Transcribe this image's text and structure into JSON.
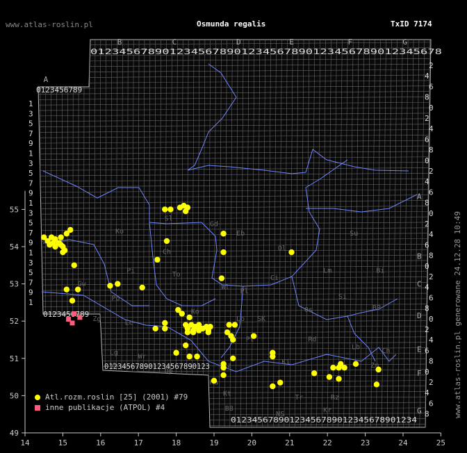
{
  "header": {
    "site": "www.atlas-roslin.pl",
    "title": "Osmunda regalis",
    "taxid": "TxID 7174"
  },
  "side_text": "www.atlas-roslin.pl generowane 24.12.28 10:49",
  "legend": [
    {
      "label": "Atl.rozm.roslin [25] (2001) #79",
      "color": "#ffff00",
      "shape": "circle"
    },
    {
      "label": "inne publikacje (ATPOL) #4",
      "color": "#ff5a7a",
      "shape": "square"
    }
  ],
  "chart_data": {
    "type": "scatter",
    "x_axis": {
      "range": [
        14,
        25
      ],
      "ticks": [
        14,
        15,
        16,
        17,
        18,
        19,
        20,
        21,
        22,
        23,
        24,
        25
      ]
    },
    "y_axis": {
      "range": [
        49,
        55.5
      ],
      "ticks": [
        49,
        50,
        51,
        52,
        53,
        54,
        55
      ]
    },
    "atpol_columns": [
      {
        "letter": "A",
        "lon": 14.55
      },
      {
        "letter": "B",
        "lon": 16.5
      },
      {
        "letter": "C",
        "lon": 17.95
      },
      {
        "letter": "D",
        "lon": 19.65
      },
      {
        "letter": "E",
        "lon": 21.05
      },
      {
        "letter": "F",
        "lon": 22.6
      },
      {
        "letter": "G",
        "lon": 24.05
      }
    ],
    "atpol_rows": [
      {
        "letter": "A",
        "lat": 55.35
      },
      {
        "letter": "B",
        "lat": 53.75
      },
      {
        "letter": "C",
        "lat": 53.0
      },
      {
        "letter": "D",
        "lat": 52.15
      },
      {
        "letter": "E",
        "lat": 51.25
      },
      {
        "letter": "F",
        "lat": 50.6
      },
      {
        "letter": "G",
        "lat": 49.6
      }
    ],
    "region_labels": [
      {
        "text": "Sl",
        "lon": 17.8,
        "lat": 54.7
      },
      {
        "text": "Gd",
        "lon": 19.0,
        "lat": 54.55
      },
      {
        "text": "Eb",
        "lon": 19.7,
        "lat": 54.3
      },
      {
        "text": "Su",
        "lon": 22.7,
        "lat": 54.3
      },
      {
        "text": "Ko",
        "lon": 16.5,
        "lat": 54.35
      },
      {
        "text": "Ol",
        "lon": 20.8,
        "lat": 53.9
      },
      {
        "text": "Ch",
        "lon": 17.75,
        "lat": 53.8
      },
      {
        "text": "Bi",
        "lon": 23.4,
        "lat": 53.3
      },
      {
        "text": "Lm",
        "lon": 22.0,
        "lat": 53.3
      },
      {
        "text": "Ci",
        "lon": 20.6,
        "lat": 53.1
      },
      {
        "text": "Pi",
        "lon": 16.8,
        "lat": 53.3
      },
      {
        "text": "To",
        "lon": 18.0,
        "lat": 53.2
      },
      {
        "text": "Wl",
        "lon": 19.3,
        "lat": 52.85
      },
      {
        "text": "Gw",
        "lon": 15.5,
        "lat": 52.95
      },
      {
        "text": "Pl",
        "lon": 19.8,
        "lat": 52.75
      },
      {
        "text": "Os",
        "lon": 21.5,
        "lat": 52.25
      },
      {
        "text": "Si",
        "lon": 22.4,
        "lat": 52.6
      },
      {
        "text": "BP",
        "lon": 23.3,
        "lat": 52.3
      },
      {
        "text": "Po",
        "lon": 16.4,
        "lat": 52.55
      },
      {
        "text": "Zg",
        "lon": 15.9,
        "lat": 52.0
      },
      {
        "text": "Ko",
        "lon": 18.5,
        "lat": 52.2
      },
      {
        "text": "Lo",
        "lon": 19.7,
        "lat": 52.0
      },
      {
        "text": "SK",
        "lon": 20.25,
        "lat": 52.0
      },
      {
        "text": "Le",
        "lon": 16.75,
        "lat": 51.9
      },
      {
        "text": "Ka",
        "lon": 18.3,
        "lat": 51.8
      },
      {
        "text": "Pt",
        "lon": 19.95,
        "lat": 51.45
      },
      {
        "text": "Rd",
        "lon": 21.6,
        "lat": 51.45
      },
      {
        "text": "Lb",
        "lon": 22.75,
        "lat": 51.25
      },
      {
        "text": "Lg",
        "lon": 16.35,
        "lat": 51.1
      },
      {
        "text": "Wr",
        "lon": 17.1,
        "lat": 51.0
      },
      {
        "text": "Ch",
        "lon": 23.55,
        "lat": 51.15
      },
      {
        "text": "Ki",
        "lon": 20.9,
        "lat": 50.85
      },
      {
        "text": "Cz",
        "lon": 19.35,
        "lat": 50.75
      },
      {
        "text": "Wb",
        "lon": 16.35,
        "lat": 50.75
      },
      {
        "text": "Op",
        "lon": 17.8,
        "lat": 50.6
      },
      {
        "text": "Zm",
        "lon": 23.25,
        "lat": 50.75
      },
      {
        "text": "Ka",
        "lon": 19.0,
        "lat": 50.3
      },
      {
        "text": "Kt",
        "lon": 19.35,
        "lat": 50.0
      },
      {
        "text": "Tr",
        "lon": 21.25,
        "lat": 49.9
      },
      {
        "text": "Rz",
        "lon": 22.2,
        "lat": 49.9
      },
      {
        "text": "Kr",
        "lon": 22.0,
        "lat": 49.55
      },
      {
        "text": "BB",
        "lon": 19.4,
        "lat": 49.6
      },
      {
        "text": "NS",
        "lon": 20.75,
        "lat": 49.45
      }
    ],
    "series": [
      {
        "name": "Atl.rozm.roslin [25] (2001) #79",
        "points": [
          [
            14.5,
            54.25
          ],
          [
            14.6,
            54.15
          ],
          [
            14.7,
            54.25
          ],
          [
            14.65,
            54.05
          ],
          [
            14.8,
            54.2
          ],
          [
            14.9,
            54.1
          ],
          [
            14.95,
            54.25
          ],
          [
            15.1,
            54.35
          ],
          [
            15.0,
            54.0
          ],
          [
            15.05,
            53.9
          ],
          [
            14.95,
            54.05
          ],
          [
            15.0,
            53.85
          ],
          [
            14.75,
            54.1
          ],
          [
            14.8,
            54.0
          ],
          [
            15.2,
            54.45
          ],
          [
            15.3,
            53.5
          ],
          [
            15.1,
            52.85
          ],
          [
            15.4,
            52.85
          ],
          [
            15.25,
            52.55
          ],
          [
            16.25,
            52.95
          ],
          [
            16.45,
            53.0
          ],
          [
            17.1,
            52.9
          ],
          [
            17.7,
            55.0
          ],
          [
            17.85,
            55.0
          ],
          [
            18.1,
            55.05
          ],
          [
            18.2,
            55.1
          ],
          [
            18.3,
            55.05
          ],
          [
            18.25,
            54.95
          ],
          [
            17.75,
            54.15
          ],
          [
            17.5,
            53.65
          ],
          [
            19.25,
            54.35
          ],
          [
            19.25,
            53.85
          ],
          [
            21.05,
            53.85
          ],
          [
            19.2,
            53.15
          ],
          [
            17.45,
            51.8
          ],
          [
            17.7,
            51.95
          ],
          [
            17.7,
            51.8
          ],
          [
            18.05,
            52.3
          ],
          [
            18.15,
            52.2
          ],
          [
            18.35,
            52.1
          ],
          [
            18.25,
            51.9
          ],
          [
            18.4,
            51.9
          ],
          [
            18.3,
            51.8
          ],
          [
            18.5,
            51.85
          ],
          [
            18.45,
            51.75
          ],
          [
            18.6,
            51.9
          ],
          [
            18.6,
            51.75
          ],
          [
            18.7,
            51.8
          ],
          [
            18.8,
            51.85
          ],
          [
            18.9,
            51.85
          ],
          [
            18.85,
            51.75
          ],
          [
            18.3,
            51.7
          ],
          [
            18.45,
            51.7
          ],
          [
            18.85,
            51.7
          ],
          [
            19.4,
            51.9
          ],
          [
            19.55,
            51.9
          ],
          [
            19.35,
            51.7
          ],
          [
            19.45,
            51.6
          ],
          [
            19.5,
            51.5
          ],
          [
            20.05,
            51.6
          ],
          [
            18.25,
            51.35
          ],
          [
            18.0,
            51.15
          ],
          [
            18.35,
            51.05
          ],
          [
            18.55,
            51.05
          ],
          [
            19.5,
            51.0
          ],
          [
            20.55,
            51.05
          ],
          [
            20.55,
            51.15
          ],
          [
            19.25,
            50.85
          ],
          [
            19.25,
            50.75
          ],
          [
            19.25,
            50.55
          ],
          [
            19.0,
            50.4
          ],
          [
            20.55,
            50.25
          ],
          [
            20.75,
            50.35
          ],
          [
            21.65,
            50.6
          ],
          [
            22.15,
            50.75
          ],
          [
            22.35,
            50.85
          ],
          [
            22.3,
            50.75
          ],
          [
            22.45,
            50.75
          ],
          [
            22.75,
            50.85
          ],
          [
            22.3,
            50.45
          ],
          [
            22.05,
            50.5
          ],
          [
            23.35,
            50.7
          ],
          [
            23.3,
            50.3
          ]
        ]
      },
      {
        "name": "inne publikacje (ATPOL) #4",
        "points": [
          [
            15.3,
            52.2
          ],
          [
            15.45,
            52.1
          ],
          [
            15.15,
            52.05
          ],
          [
            15.25,
            51.95
          ]
        ]
      }
    ]
  }
}
